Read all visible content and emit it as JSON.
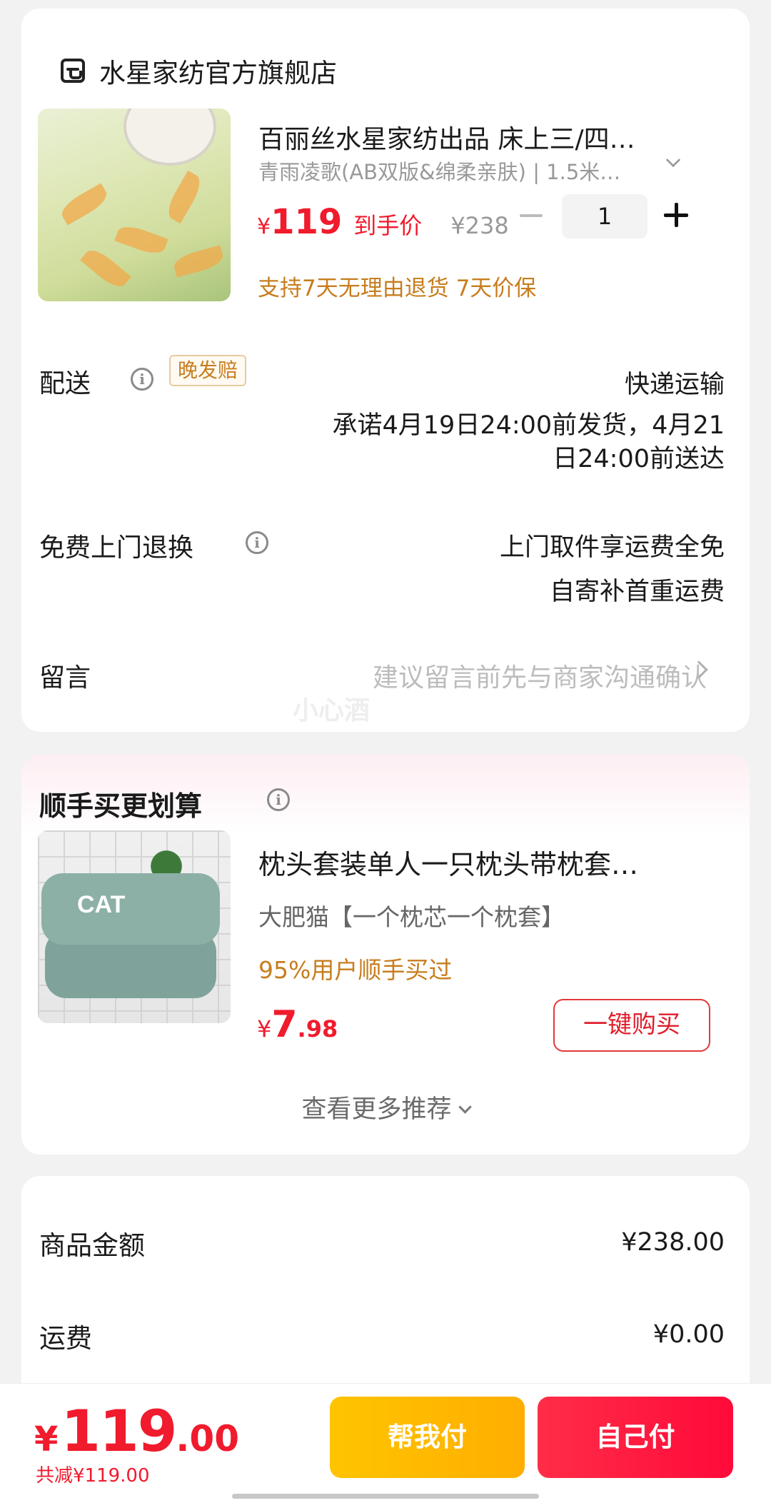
{
  "store": {
    "name": "水星家纺官方旗舰店",
    "icon": "store-icon"
  },
  "product": {
    "title": "百丽丝水星家纺出品 床上三/四…",
    "spec": "青雨凌歌(AB双版&绵柔亲肤) | 1.5米…",
    "price_symbol": "¥",
    "price": "119",
    "price_tag": "到手价",
    "original_price": "¥238",
    "quantity": "1",
    "guarantee": "支持7天无理由退货  7天价保"
  },
  "delivery": {
    "label": "配送",
    "badge": "晚发赔",
    "method": "快递运输",
    "promise_line1": "承诺4月19日24:00前发货，4月21",
    "promise_line2": "日24:00前送达"
  },
  "returns": {
    "label": "免费上门退换",
    "line1": "上门取件享运费全免",
    "line2": "自寄补首重运费"
  },
  "message": {
    "label": "留言",
    "placeholder": "建议留言前先与商家沟通确认",
    "watermark": "小心酒"
  },
  "recommend": {
    "section_title": "顺手买更划算",
    "title": "枕头套装单人一只枕头带枕套…",
    "spec": "大肥猫【一个枕芯一个枕套】",
    "note": "95%用户顺手买过",
    "price_symbol": "¥",
    "price_int": "7",
    "price_dec": ".98",
    "buy_label": "一键购买",
    "more_label": "查看更多推荐",
    "image_text": "CAT"
  },
  "summary": {
    "goods_label": "商品金额",
    "goods_value": "¥238.00",
    "shipping_label": "运费",
    "shipping_value": "¥0.00"
  },
  "bottom": {
    "symbol": "¥",
    "total_int": "119",
    "total_dec": ".00",
    "discount": "共减¥119.00",
    "help_pay": "帮我付",
    "self_pay": "自己付"
  },
  "colors": {
    "accent_red": "#f01b2d",
    "orange": "#c87d1e",
    "yellow_button": "#ffc400",
    "red_button": "#ff2d47"
  }
}
